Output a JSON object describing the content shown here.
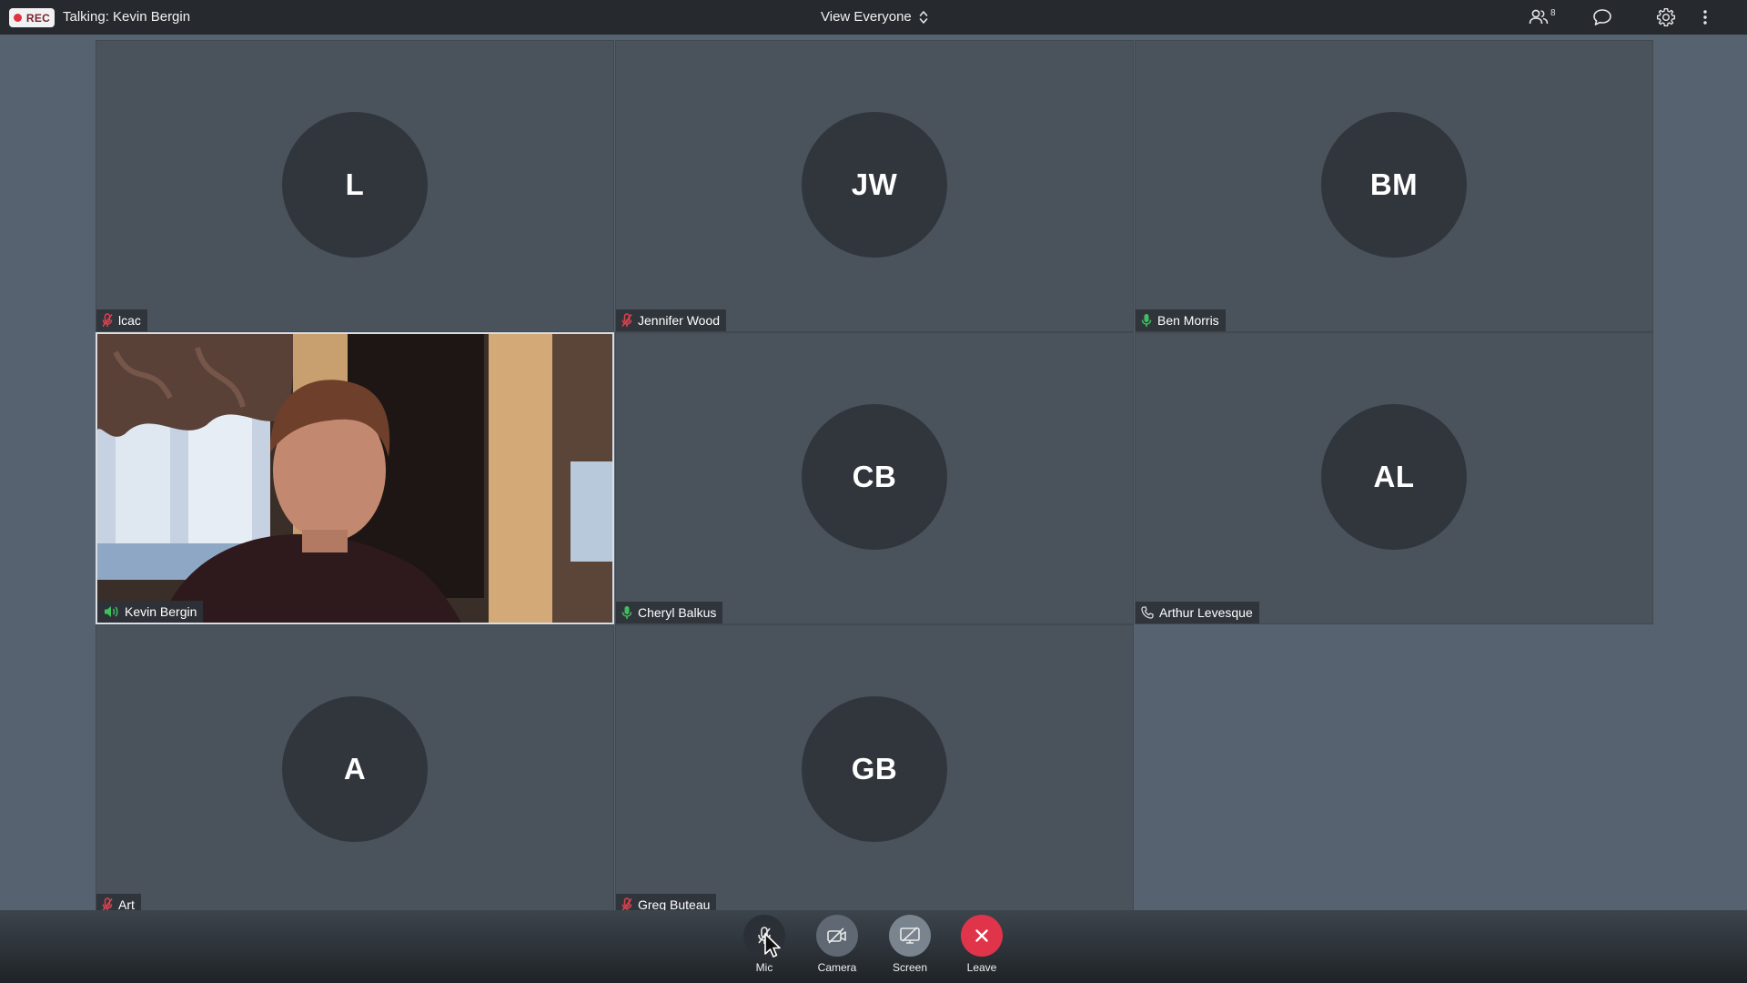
{
  "topbar": {
    "rec_label": "REC",
    "talking_text": "Talking: Kevin Bergin",
    "view_select_value": "View Everyone",
    "participants_count": "8",
    "icons": [
      "people-icon",
      "chat-icon",
      "gear-icon",
      "more-vertical-icon"
    ]
  },
  "participants": [
    {
      "initials": "L",
      "name": "lcac",
      "mic_status": "muted"
    },
    {
      "initials": "JW",
      "name": "Jennifer Wood",
      "mic_status": "muted"
    },
    {
      "initials": "BM",
      "name": "Ben Morris",
      "mic_status": "unmuted"
    },
    {
      "initials": "",
      "name": "Kevin Bergin",
      "mic_status": "speaking",
      "video": true
    },
    {
      "initials": "CB",
      "name": "Cheryl Balkus",
      "mic_status": "unmuted"
    },
    {
      "initials": "AL",
      "name": "Arthur Levesque",
      "mic_status": "phone"
    },
    {
      "initials": "A",
      "name": "Art",
      "mic_status": "muted"
    },
    {
      "initials": "GB",
      "name": "Greg Buteau",
      "mic_status": "muted"
    }
  ],
  "controls": {
    "mic_label": "Mic",
    "camera_label": "Camera",
    "screen_label": "Screen",
    "leave_label": "Leave"
  },
  "colors": {
    "background": "#566270",
    "tile": "#4a525c",
    "avatar": "#30363c",
    "muted_icon": "#e0414f",
    "unmuted_icon": "#3fbf5f",
    "leave_button": "#e0344a",
    "rec_dot": "#e0323f"
  }
}
